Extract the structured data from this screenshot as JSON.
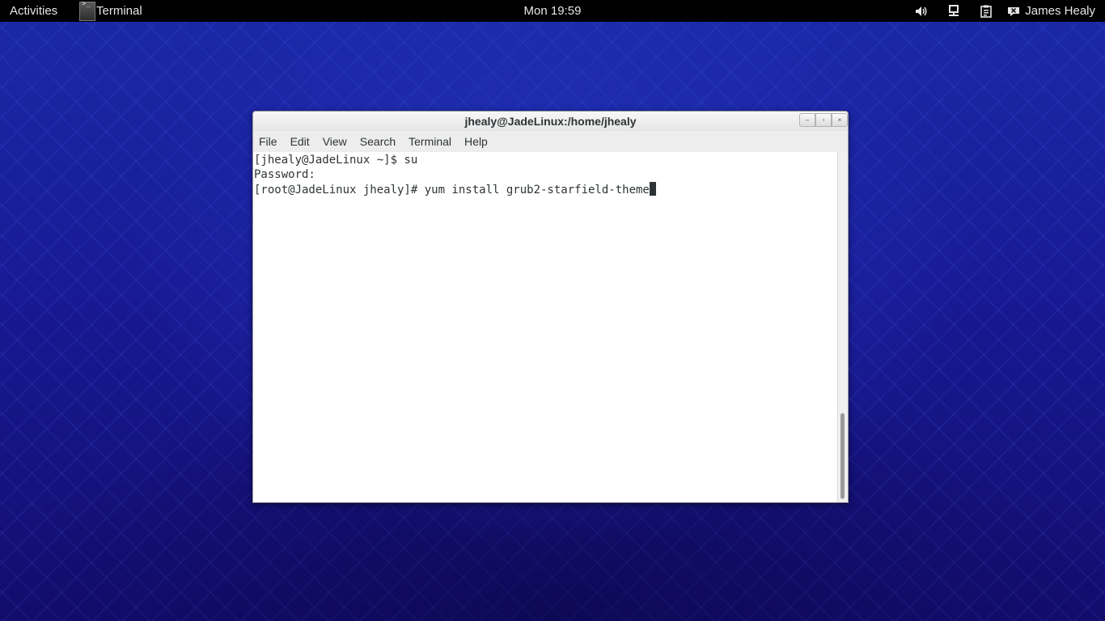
{
  "topbar": {
    "activities": "Activities",
    "app_name": "Terminal",
    "app_icon_glyph": ">_",
    "clock": "Mon 19:59",
    "tray_icons": [
      "volume-icon",
      "network-icon",
      "clipboard-icon"
    ],
    "user_name": "James Healy"
  },
  "window": {
    "title": "jhealy@JadeLinux:/home/jhealy",
    "controls": {
      "minimize": "–",
      "maximize": "▫",
      "close": "×"
    },
    "menu": [
      "File",
      "Edit",
      "View",
      "Search",
      "Terminal",
      "Help"
    ]
  },
  "terminal": {
    "lines": [
      "[jhealy@JadeLinux ~]$ su",
      "Password:",
      "[root@JadeLinux jhealy]# yum install grub2-starfield-theme"
    ]
  },
  "colors": {
    "topbar": "#000000",
    "desktop": "#16128a",
    "terminal_bg": "#ffffff",
    "terminal_text": "#2e3436"
  }
}
